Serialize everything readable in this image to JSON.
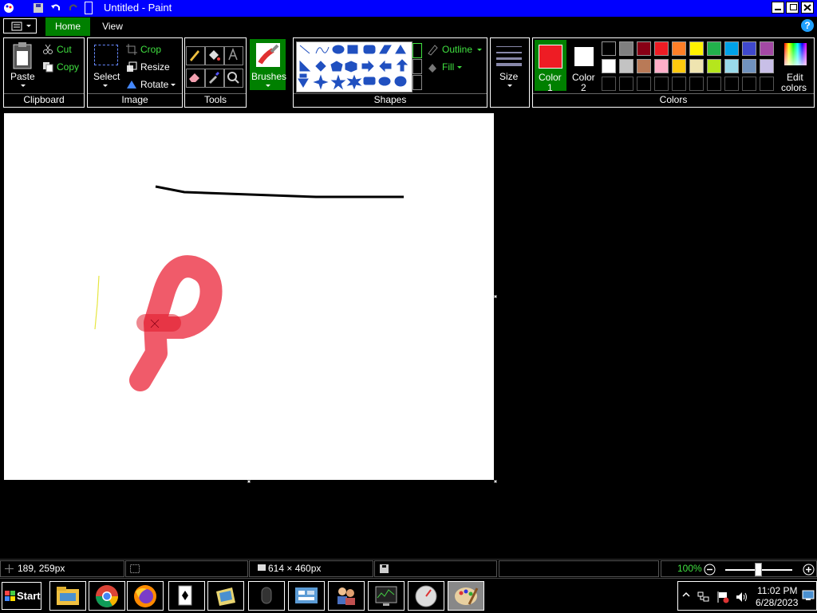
{
  "window": {
    "title": "Untitled - Paint"
  },
  "tabs": {
    "home": "Home",
    "view": "View"
  },
  "help": {
    "label": "?"
  },
  "clipboard": {
    "paste": "Paste",
    "cut": "Cut",
    "copy": "Copy",
    "group": "Clipboard"
  },
  "image": {
    "select": "Select",
    "crop": "Crop",
    "resize": "Resize",
    "rotate": "Rotate",
    "group": "Image"
  },
  "tools": {
    "group": "Tools"
  },
  "brushes": {
    "label": "Brushes"
  },
  "shapes": {
    "outline": "Outline",
    "fill": "Fill",
    "group": "Shapes"
  },
  "size": {
    "label": "Size"
  },
  "colors": {
    "color1_label": "Color",
    "color1_num": "1",
    "color2_label": "Color",
    "color2_num": "2",
    "edit_line1": "Edit",
    "edit_line2": "colors",
    "group": "Colors",
    "color1": "#ee1c24",
    "color2": "#ffffff",
    "row1": [
      "#000000",
      "#7f7f7f",
      "#880015",
      "#ed1c24",
      "#ff7f27",
      "#fff200",
      "#22b14c",
      "#00a2e8",
      "#3f48cc",
      "#a349a4"
    ],
    "row2": [
      "#ffffff",
      "#c3c3c3",
      "#b97a57",
      "#ffaec9",
      "#ffc90e",
      "#efe4b0",
      "#b5e61d",
      "#99d9ea",
      "#7092be",
      "#c8bfe7"
    ]
  },
  "status": {
    "cursor_pos": "189, 259px",
    "canvas_size": "614 × 460px",
    "zoom": "100%"
  },
  "taskbar": {
    "start": "Start",
    "time": "11:02 PM",
    "date": "6/28/2023",
    "apps": [
      "file-explorer",
      "chrome",
      "firefox",
      "solitaire",
      "briefcase",
      "mouse",
      "control-panel",
      "users",
      "task-manager",
      "network-monitor",
      "paint"
    ]
  }
}
